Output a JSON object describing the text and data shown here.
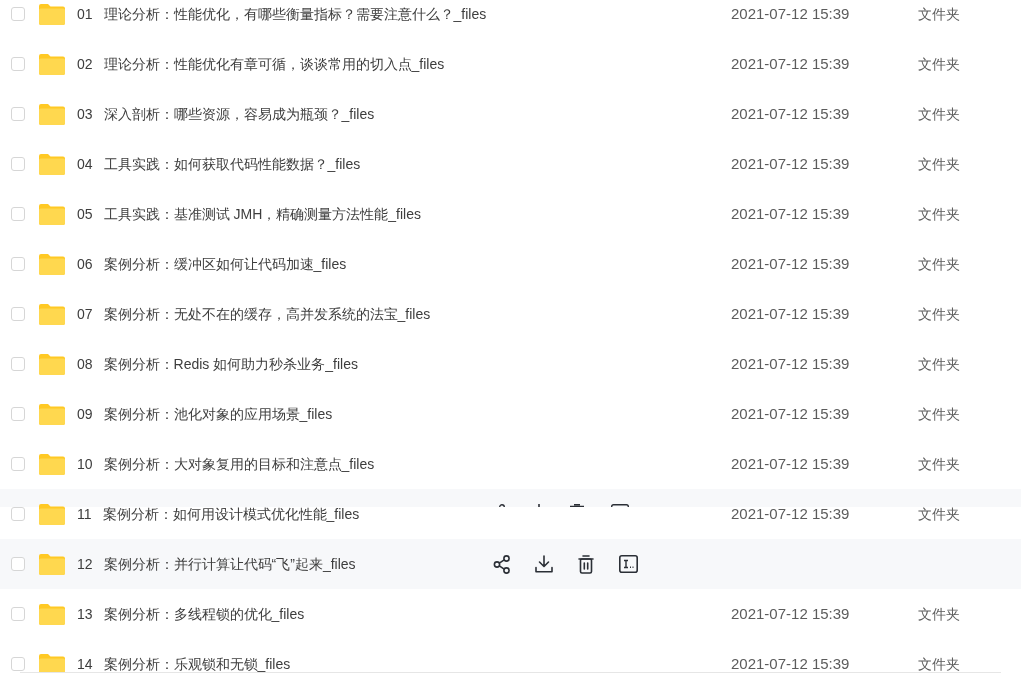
{
  "files": [
    {
      "number": "01",
      "name": "理论分析：性能优化，有哪些衡量指标？需要注意什么？_files",
      "date": "2021-07-12 15:39",
      "type": "文件夹",
      "checked": false,
      "hovered": false,
      "hover_remnant": false
    },
    {
      "number": "02",
      "name": "理论分析：性能优化有章可循，谈谈常用的切入点_files",
      "date": "2021-07-12 15:39",
      "type": "文件夹",
      "checked": false,
      "hovered": false,
      "hover_remnant": false
    },
    {
      "number": "03",
      "name": "深入剖析：哪些资源，容易成为瓶颈？_files",
      "date": "2021-07-12 15:39",
      "type": "文件夹",
      "checked": false,
      "hovered": false,
      "hover_remnant": false
    },
    {
      "number": "04",
      "name": "工具实践：如何获取代码性能数据？_files",
      "date": "2021-07-12 15:39",
      "type": "文件夹",
      "checked": false,
      "hovered": false,
      "hover_remnant": false
    },
    {
      "number": "05",
      "name": "工具实践：基准测试 JMH，精确测量方法性能_files",
      "date": "2021-07-12 15:39",
      "type": "文件夹",
      "checked": false,
      "hovered": false,
      "hover_remnant": false
    },
    {
      "number": "06",
      "name": "案例分析：缓冲区如何让代码加速_files",
      "date": "2021-07-12 15:39",
      "type": "文件夹",
      "checked": false,
      "hovered": false,
      "hover_remnant": false
    },
    {
      "number": "07",
      "name": "案例分析：无处不在的缓存，高并发系统的法宝_files",
      "date": "2021-07-12 15:39",
      "type": "文件夹",
      "checked": false,
      "hovered": false,
      "hover_remnant": false
    },
    {
      "number": "08",
      "name": "案例分析：Redis 如何助力秒杀业务_files",
      "date": "2021-07-12 15:39",
      "type": "文件夹",
      "checked": false,
      "hovered": false,
      "hover_remnant": false
    },
    {
      "number": "09",
      "name": "案例分析：池化对象的应用场景_files",
      "date": "2021-07-12 15:39",
      "type": "文件夹",
      "checked": false,
      "hovered": false,
      "hover_remnant": false
    },
    {
      "number": "10",
      "name": "案例分析：大对象复用的目标和注意点_files",
      "date": "2021-07-12 15:39",
      "type": "文件夹",
      "checked": false,
      "hovered": false,
      "hover_remnant": false
    },
    {
      "number": "11",
      "name": "案例分析：如何用设计模式优化性能_files",
      "date": "2021-07-12 15:39",
      "type": "文件夹",
      "checked": false,
      "hovered": false,
      "hover_remnant": true
    },
    {
      "number": "12",
      "name": "案例分析：并行计算让代码“飞”起来_files",
      "checked": false,
      "hovered": true,
      "hover_remnant": false
    },
    {
      "number": "13",
      "name": "案例分析：多线程锁的优化_files",
      "date": "2021-07-12 15:39",
      "type": "文件夹",
      "checked": false,
      "hovered": false,
      "hover_remnant": false
    },
    {
      "number": "14",
      "name": "案例分析：乐观锁和无锁_files",
      "date": "2021-07-12 15:39",
      "type": "文件夹",
      "checked": false,
      "hovered": false,
      "hover_remnant": false
    }
  ]
}
